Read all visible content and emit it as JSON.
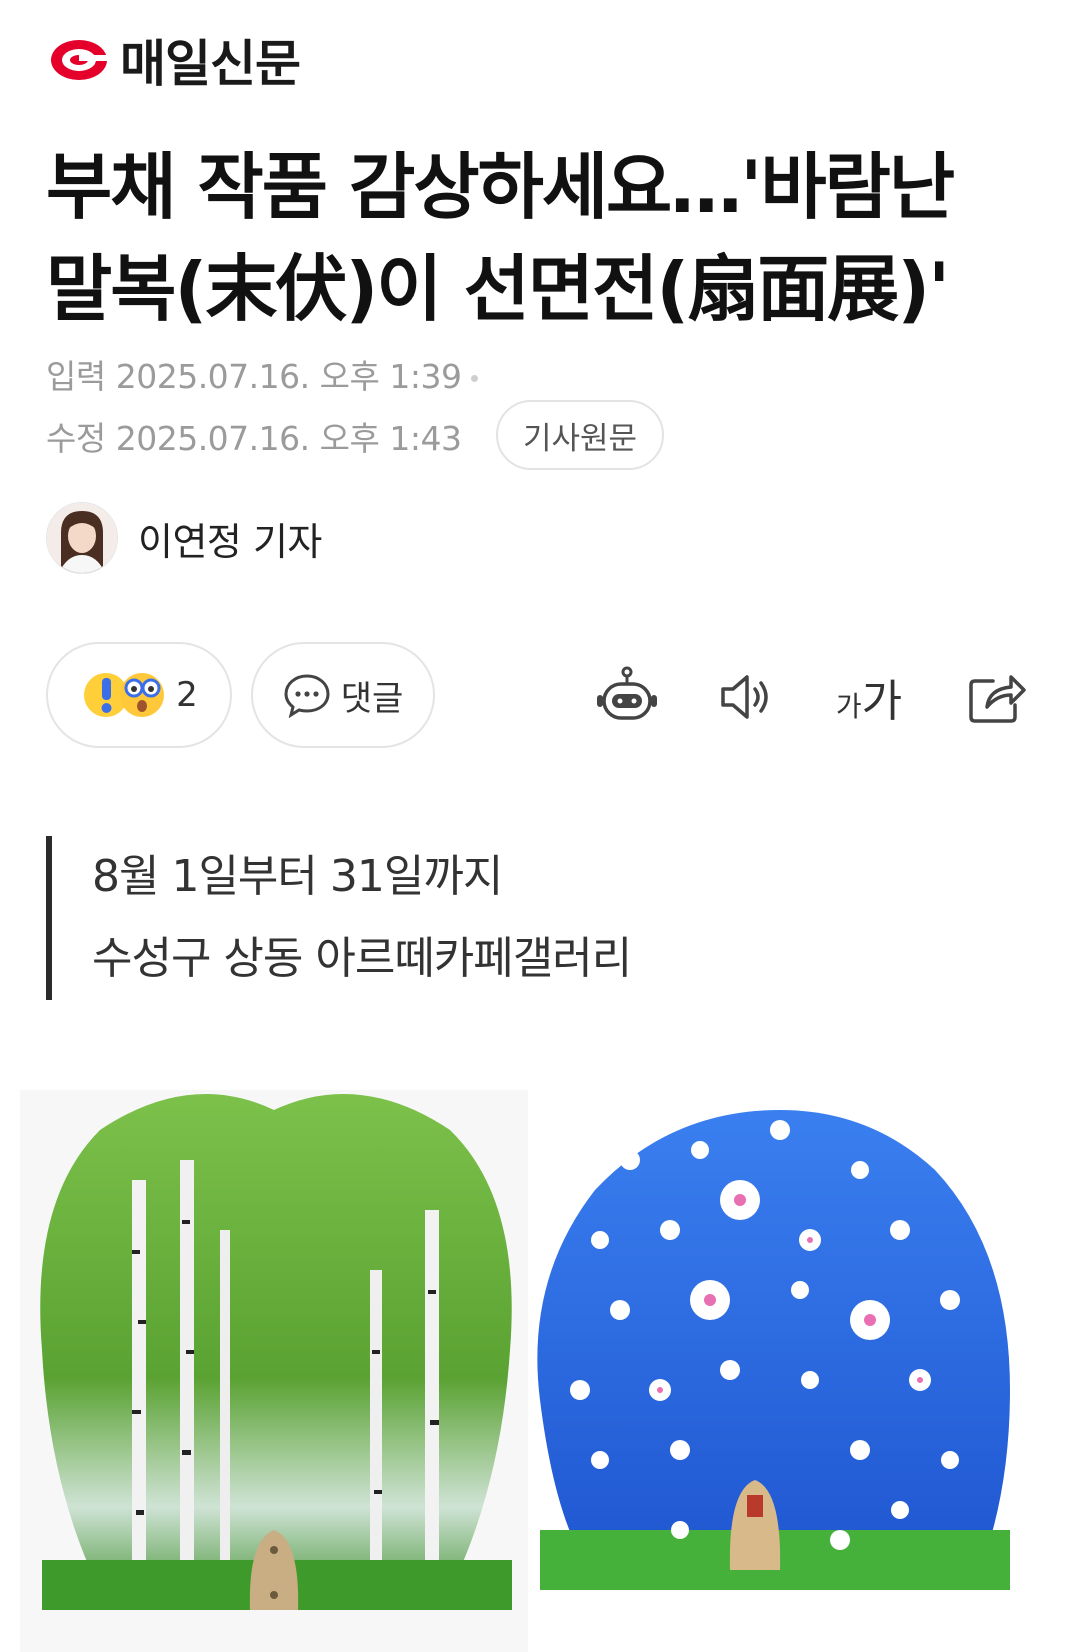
{
  "brand": {
    "name": "매일신문",
    "color": "#e4002b"
  },
  "article": {
    "title_line1": "부채 작품 감상하세요…'바람난",
    "title_line2": "말복(末伏)이 선면전(扇面展)'",
    "published": "입력 2025.07.16. 오후 1:39",
    "modified": "수정 2025.07.16. 오후 1:43",
    "source_button": "기사원문",
    "author": "이연정 기자",
    "summary": [
      "8월 1일부터 31일까지",
      "수성구 상동 아르떼카페갤러리"
    ]
  },
  "actions": {
    "reaction_count": "2",
    "comment_label": "댓글",
    "font_small": "가",
    "font_large": "가"
  },
  "icons": {
    "reaction": "reaction-emoji-icon",
    "comment": "comment-bubble-icon",
    "summary_bot": "robot-icon",
    "tts": "speaker-icon",
    "font_size": "font-size-icon",
    "share": "share-icon"
  },
  "image": {
    "description_colors": {
      "left_fan": "#6fb43a",
      "right_fan": "#2f6fe0"
    }
  }
}
